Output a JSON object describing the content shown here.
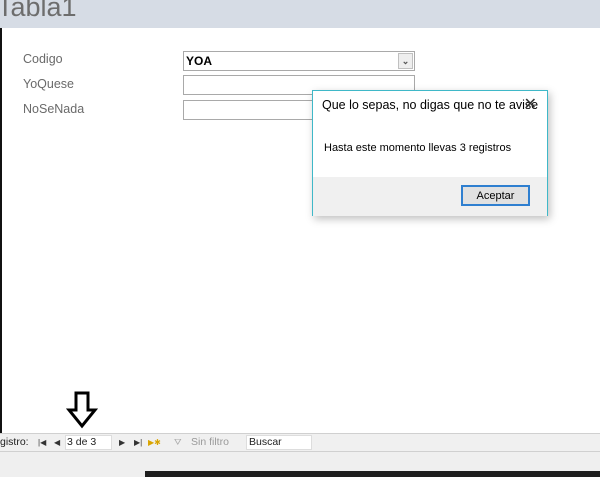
{
  "form": {
    "title": "Tabla1",
    "fields": [
      {
        "label": "Codigo",
        "value": "YOA"
      },
      {
        "label": "YoQuese",
        "value": ""
      },
      {
        "label": "NoSeNada",
        "value": ""
      }
    ]
  },
  "dialog": {
    "title": "Que lo sepas, no digas que no te avise",
    "message": "Hasta este momento llevas 3 registros",
    "ok_label": "Aceptar",
    "close_glyph": "✕"
  },
  "nav": {
    "label": "gistro:",
    "record": "3 de 3",
    "filter": "Sin filtro",
    "search": "Buscar"
  }
}
